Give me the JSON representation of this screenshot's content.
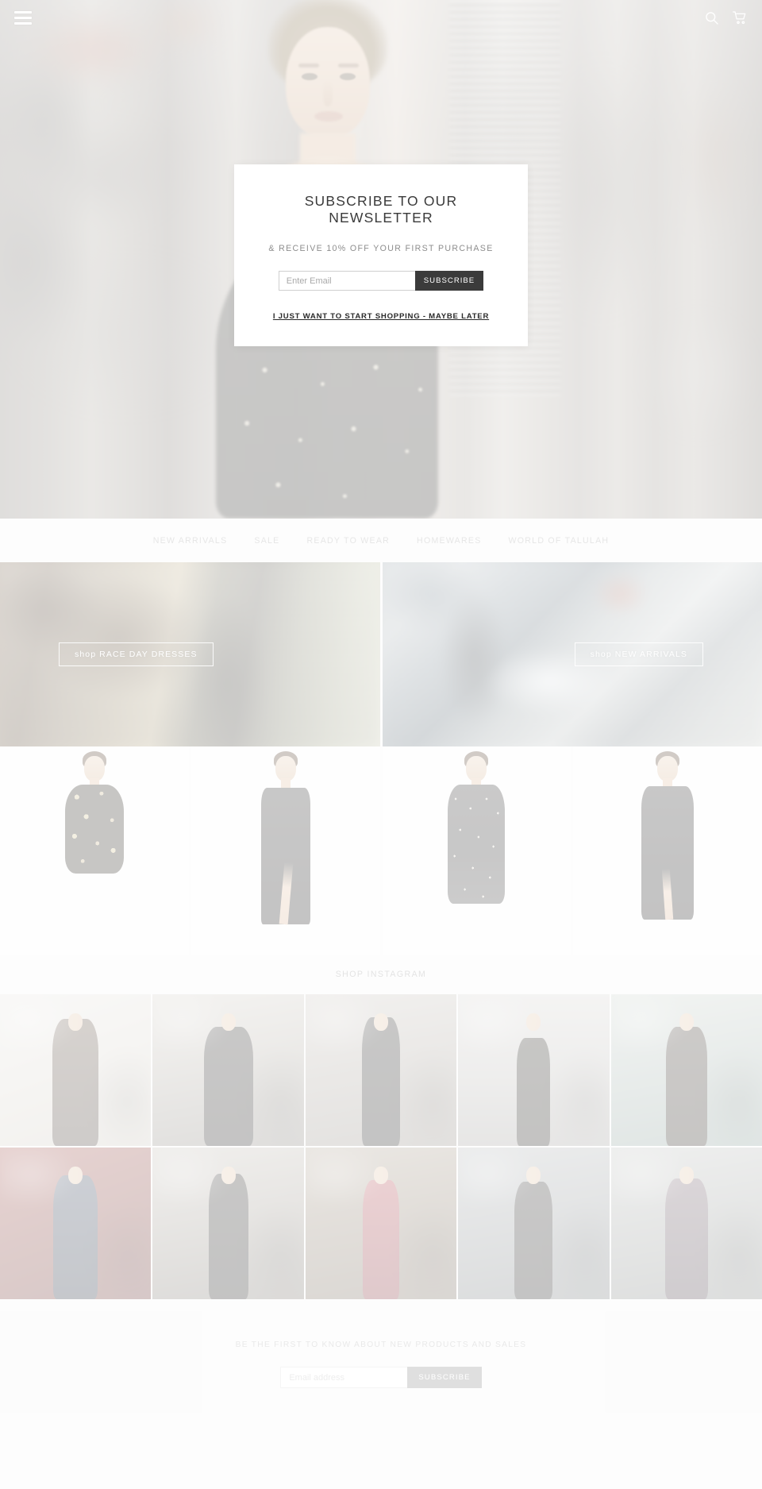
{
  "header": {
    "menu_icon": "hamburger-menu-icon",
    "search_icon": "search-icon",
    "cart_icon": "shopping-cart-icon"
  },
  "newsletter_modal": {
    "title": "SUBSCRIBE TO OUR NEWSLETTER",
    "subtitle": "& RECEIVE 10% OFF YOUR FIRST PURCHASE",
    "email_placeholder": "Enter Email",
    "email_value": "",
    "subscribe_label": "SUBSCRIBE",
    "skip_label": "I JUST WANT TO START SHOPPING - MAYBE LATER",
    "background_color": "#ffffff",
    "button_color": "#3b3b3b"
  },
  "main_nav": {
    "items": [
      {
        "label": "NEW ARRIVALS"
      },
      {
        "label": "SALE"
      },
      {
        "label": "READY TO WEAR"
      },
      {
        "label": "HOMEWARES"
      },
      {
        "label": "WORLD OF TALULAH"
      }
    ]
  },
  "banners": [
    {
      "cta_label": "shop RACE DAY DRESSES",
      "name": "race-day-dresses"
    },
    {
      "cta_label": "shop NEW ARRIVALS",
      "name": "new-arrivals"
    }
  ],
  "product_row": {
    "items": [
      {
        "name": "product-floral-mini-dress"
      },
      {
        "name": "product-black-strapless-gown"
      },
      {
        "name": "product-polka-dot-midi-dress"
      },
      {
        "name": "product-black-cold-shoulder-gown"
      }
    ]
  },
  "instagram": {
    "heading": "SHOP INSTAGRAM",
    "cells": [
      {
        "name": "instagram-post-1"
      },
      {
        "name": "instagram-post-2"
      },
      {
        "name": "instagram-post-3"
      },
      {
        "name": "instagram-post-4"
      },
      {
        "name": "instagram-post-5"
      },
      {
        "name": "instagram-post-6"
      },
      {
        "name": "instagram-post-7"
      },
      {
        "name": "instagram-post-8"
      },
      {
        "name": "instagram-post-9"
      },
      {
        "name": "instagram-post-10"
      }
    ]
  },
  "footer_newsletter": {
    "tagline": "BE THE FIRST TO KNOW ABOUT NEW PRODUCTS AND SALES",
    "email_placeholder": "Email address",
    "email_value": "",
    "subscribe_label": "SUBSCRIBE",
    "button_color": "#8d8d8d"
  },
  "theme": {
    "page_background": "#f6f6f6",
    "nav_text_color": "#a7a7a7",
    "heading_color": "#3a3a3a"
  }
}
